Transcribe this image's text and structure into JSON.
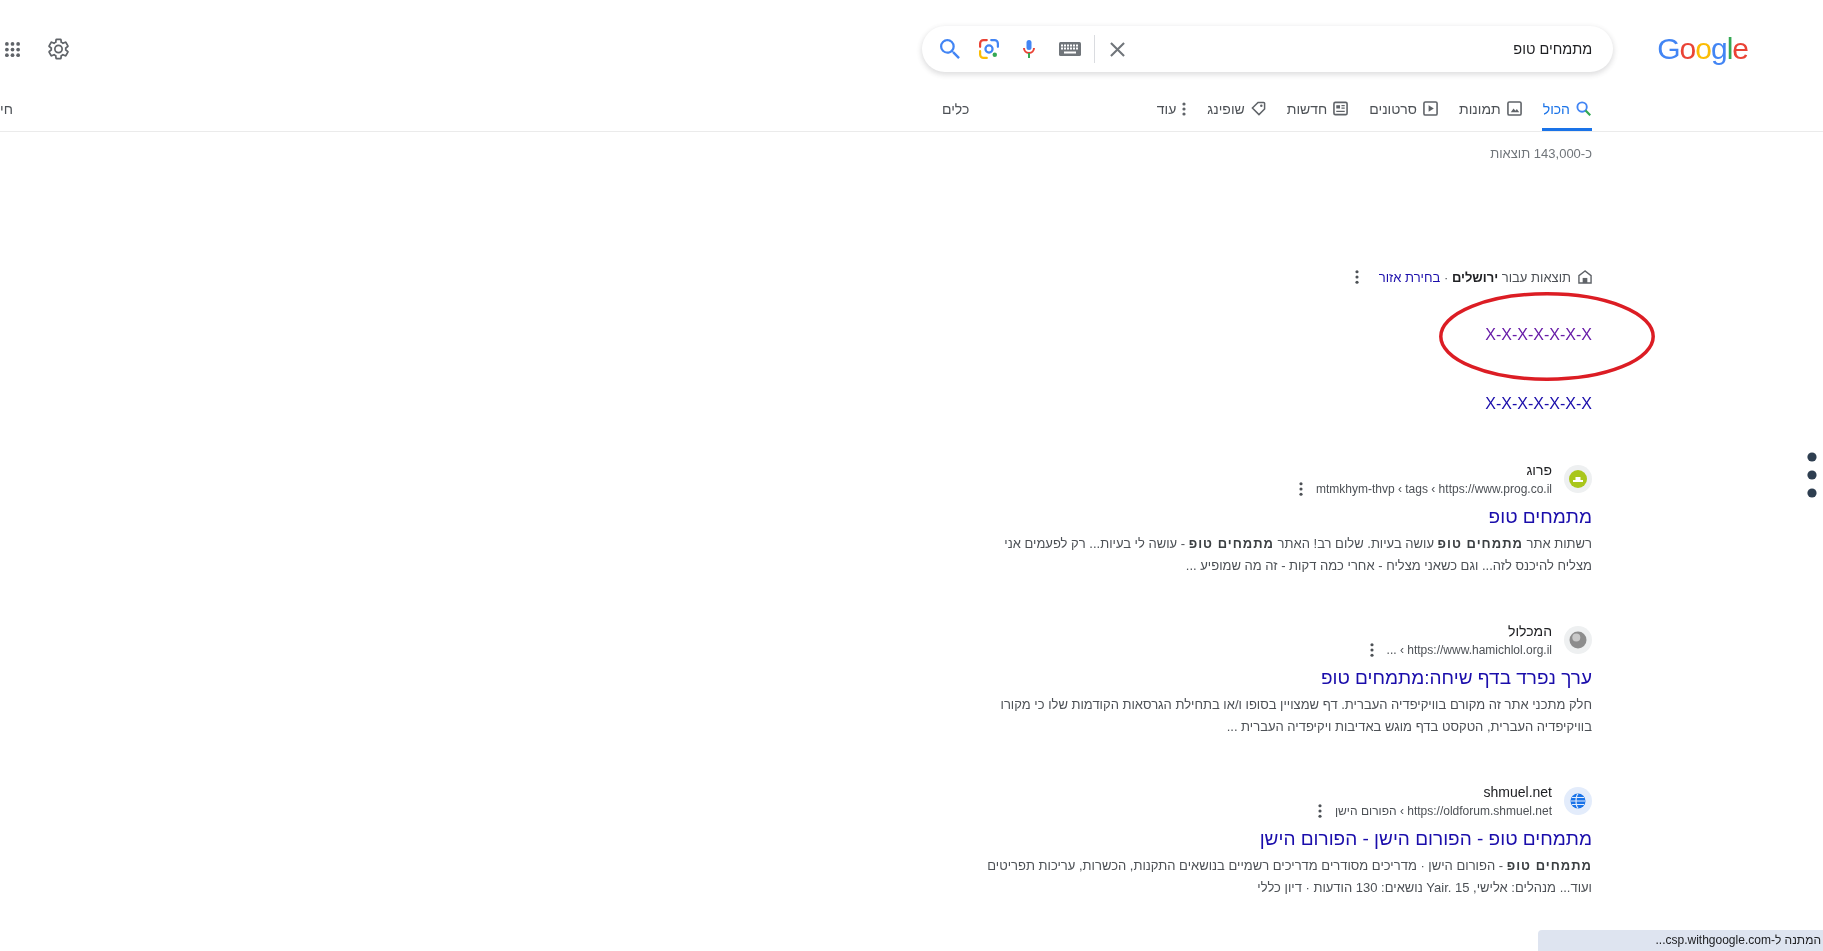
{
  "header": {
    "logo": "Google",
    "search": {
      "value": "מתמחים טופ"
    }
  },
  "tabs": [
    {
      "label": "הכול",
      "kind": "all",
      "selected": true
    },
    {
      "label": "תמונות",
      "kind": "images",
      "selected": false
    },
    {
      "label": "סרטונים",
      "kind": "videos",
      "selected": false
    },
    {
      "label": "חדשות",
      "kind": "news",
      "selected": false
    },
    {
      "label": "שופינג",
      "kind": "shopping",
      "selected": false
    },
    {
      "label": "עוד",
      "kind": "more",
      "selected": false
    }
  ],
  "tools": "כלים",
  "edge_label": "חי",
  "result_count": "כ-143,000 תוצאות",
  "location": {
    "text": "תוצאות עבור **ירושלים**",
    "separator": "·",
    "link": "בחירת אזור"
  },
  "local_links": [
    {
      "text": "X-X-X-X-X-X-X",
      "visited": true,
      "circled": true
    },
    {
      "text": "X-X-X-X-X-X-X",
      "visited": false,
      "circled": false
    }
  ],
  "results": [
    {
      "favicon": {
        "kind": "logo"
      },
      "site": "פרוג",
      "url": "mtmkhym-thvp ‹ tags ‹ https://www.prog.co.il",
      "title": "מתמחים טופ",
      "snippet": "רשתות אתר **מתמחים טופ** עושה בעיות. שלום רב! האתר **מתמחים טופ** - עושה לי בעיות... רק לפעמים אני מצליח להיכנס לזה... וגם כשאני מצליח - אחרי כמה דקות - זה מה שמופיע ..."
    },
    {
      "favicon": {
        "kind": "emblem"
      },
      "site": "המכלול",
      "url": "... ‹ https://www.hamichlol.org.il",
      "title": "ערך נפרד בדף שיחה:מתמחים טופ",
      "snippet": "חלק מתכני אתר זה מקורם בוויקיפדיה העברית. דף שמצויין בסופו ו/או בתחילת הגרסאות הקודמות שלו כי מקורו בוויקיפדיה העברית, הטקסט בדף מוגש באדיבות ויקיפדיה העברית ..."
    },
    {
      "favicon": {
        "kind": "globe"
      },
      "site": "shmuel.net",
      "url": "הפורום הישן ‹ https://oldforum.shmuel.net",
      "title": "מתמחים טופ - הפורום הישן - הפורום הישן",
      "snippet": "**מתמחים טופ** - הפורום הישן · מדריכים מסודרים מדריכים רשמיים בנושאים התקנות, הכשרות, עריכות תפריטים ועוד... מנהלים: אלישי, Yair. 15 נושאים: 130 הודעות · דיון כללי"
    }
  ],
  "status_bubble": "המתנה ל-csp.withgoogle.com..."
}
